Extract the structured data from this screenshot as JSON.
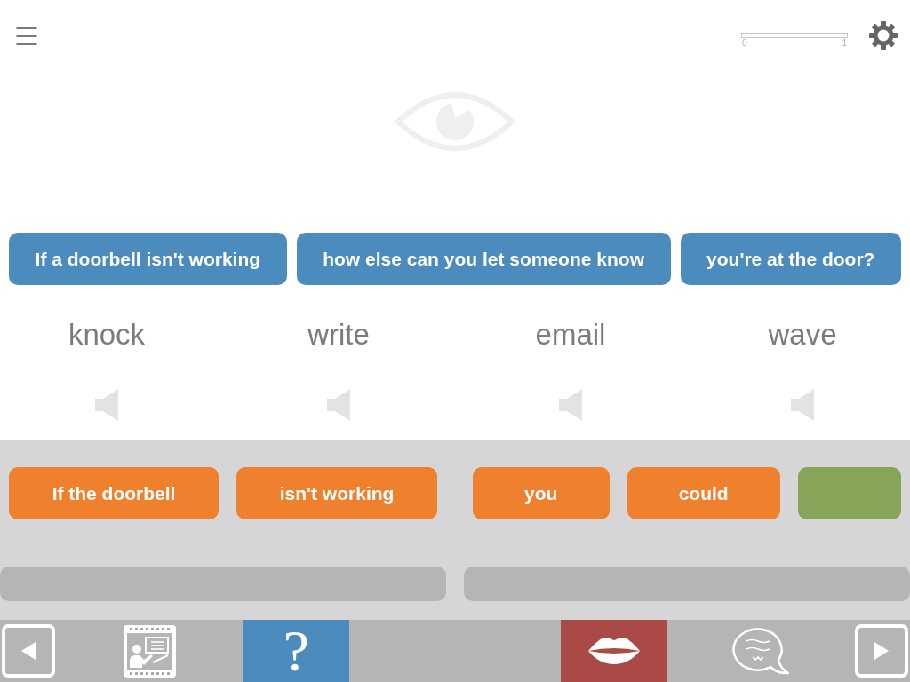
{
  "header": {
    "progress": {
      "min_label": "0",
      "max_label": "1"
    }
  },
  "prompt": [
    "If a doorbell isn't working",
    "how else can you let someone know",
    "you're at the door?"
  ],
  "choices": [
    {
      "word": "knock"
    },
    {
      "word": "write"
    },
    {
      "word": "email"
    },
    {
      "word": "wave"
    }
  ],
  "answer_groups": [
    {
      "tiles": [
        {
          "label": "If the doorbell",
          "color": "#ef802e"
        },
        {
          "label": "isn't working",
          "color": "#ef802e"
        }
      ]
    },
    {
      "tiles": [
        {
          "label": "you",
          "color": "#ef802e"
        },
        {
          "label": "could",
          "color": "#ef802e"
        },
        {
          "color": "#87a559"
        }
      ]
    }
  ],
  "bottom_bar": [
    {
      "kind": "back"
    },
    {
      "kind": "lesson"
    },
    {
      "kind": "help",
      "label": "?"
    },
    {
      "kind": "speak"
    },
    {
      "kind": "chat"
    },
    {
      "kind": "forward"
    }
  ]
}
